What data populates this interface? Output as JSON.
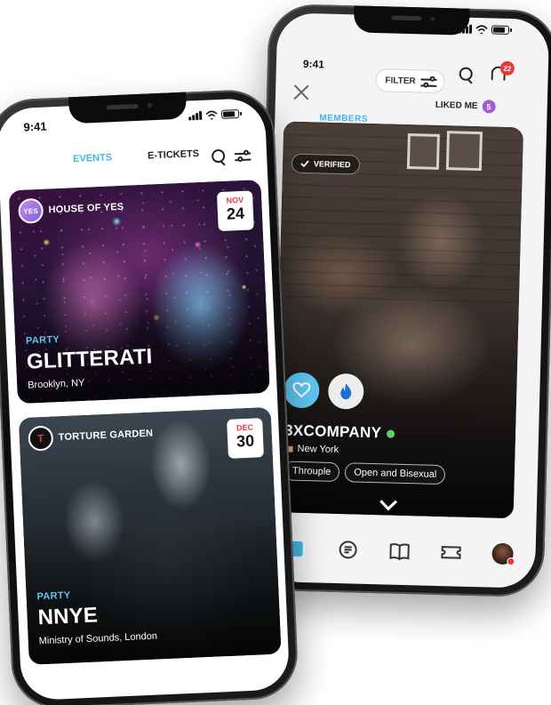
{
  "back_phone": {
    "status_time": "9:41",
    "filter_label": "FILTER",
    "notifications_count": "22",
    "members_tab": "MEMBERS",
    "liked_me_label": "LIKED ME",
    "liked_me_count": "5",
    "member": {
      "verified_label": "VERIFIED",
      "name": "3XCOMPANY",
      "location": "New York",
      "tags": [
        "Throuple",
        "Open and Bisexual"
      ]
    }
  },
  "front_phone": {
    "status_time": "9:41",
    "tabs": {
      "events": "EVENTS",
      "etickets": "E-TICKETS"
    },
    "events": [
      {
        "organizer": "HOUSE OF YES",
        "organizer_logo_text": "HOUSE OF YES",
        "month": "NOV",
        "day": "24",
        "category": "PARTY",
        "title": "GLITTERATI",
        "location": "Brooklyn, NY"
      },
      {
        "organizer": "TORTURE GARDEN",
        "organizer_logo_text": "TG",
        "month": "DEC",
        "day": "30",
        "category": "PARTY",
        "title": "NNYE",
        "location": "Ministry of Sounds, London"
      }
    ]
  },
  "colors": {
    "accent": "#41b6e6",
    "heart_button": "#5ec4ee",
    "date_month": "#e23b3b",
    "badge_purple": "#a65cd9",
    "online": "#5fd16b"
  }
}
